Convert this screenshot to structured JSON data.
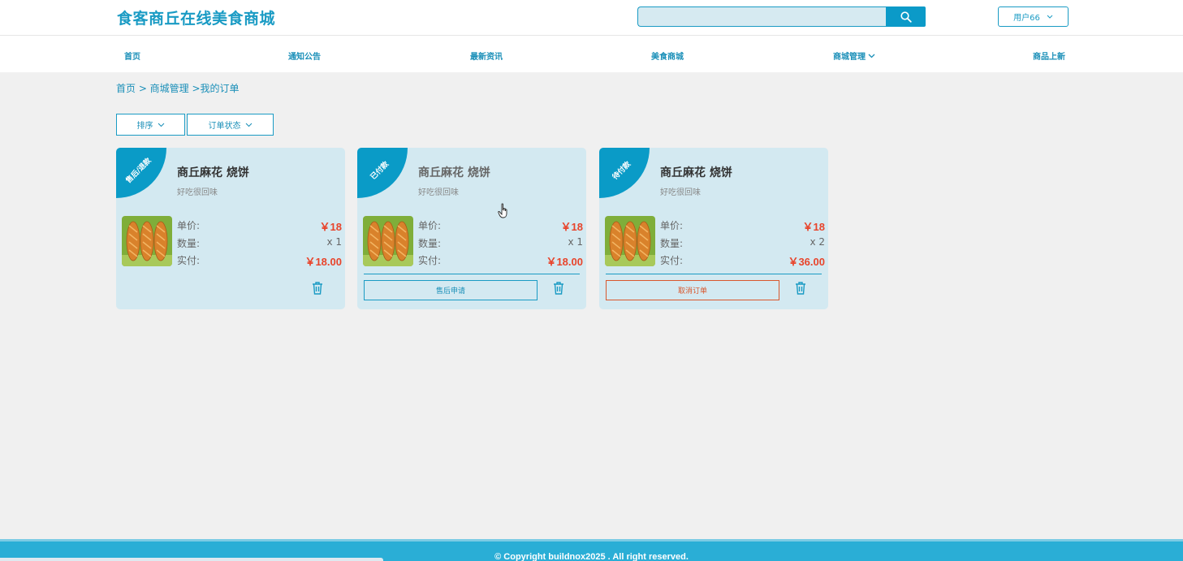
{
  "header": {
    "brand": "食客商丘在线美食商城",
    "search_placeholder": "",
    "user_label": "用户66"
  },
  "nav": {
    "items": [
      {
        "label": "首页"
      },
      {
        "label": "通知公告"
      },
      {
        "label": "最新资讯"
      },
      {
        "label": "美食商城"
      },
      {
        "label": "商城管理"
      },
      {
        "label": "商品上新"
      }
    ]
  },
  "breadcrumb": "首页 > 商城管理 >我的订单",
  "filters": {
    "sort_label": "排序",
    "status_label": "订单状态"
  },
  "labels": {
    "unit_price": "单价:",
    "quantity": "数量:",
    "paid": "实付:"
  },
  "orders": [
    {
      "status": "售后/退款",
      "title": "商丘麻花 烧饼",
      "subtitle": "好吃很回味",
      "unit_price": "￥18",
      "quantity": "x 1",
      "paid": "￥18.00",
      "action": ""
    },
    {
      "status": "已付款",
      "title": "商丘麻花 烧饼",
      "subtitle": "好吃很回味",
      "unit_price": "￥18",
      "quantity": "x 1",
      "paid": "￥18.00",
      "action": "售后申请"
    },
    {
      "status": "待付款",
      "title": "商丘麻花 烧饼",
      "subtitle": "好吃很回味",
      "unit_price": "￥18",
      "quantity": "x 2",
      "paid": "￥36.00",
      "action": "取消订单"
    }
  ],
  "footer": {
    "copyright": "© Copyright buildnox2025 . All right reserved."
  },
  "colors": {
    "accent": "#1a9bc4",
    "price": "#e8442b",
    "card_bg": "#d3e9f1"
  }
}
